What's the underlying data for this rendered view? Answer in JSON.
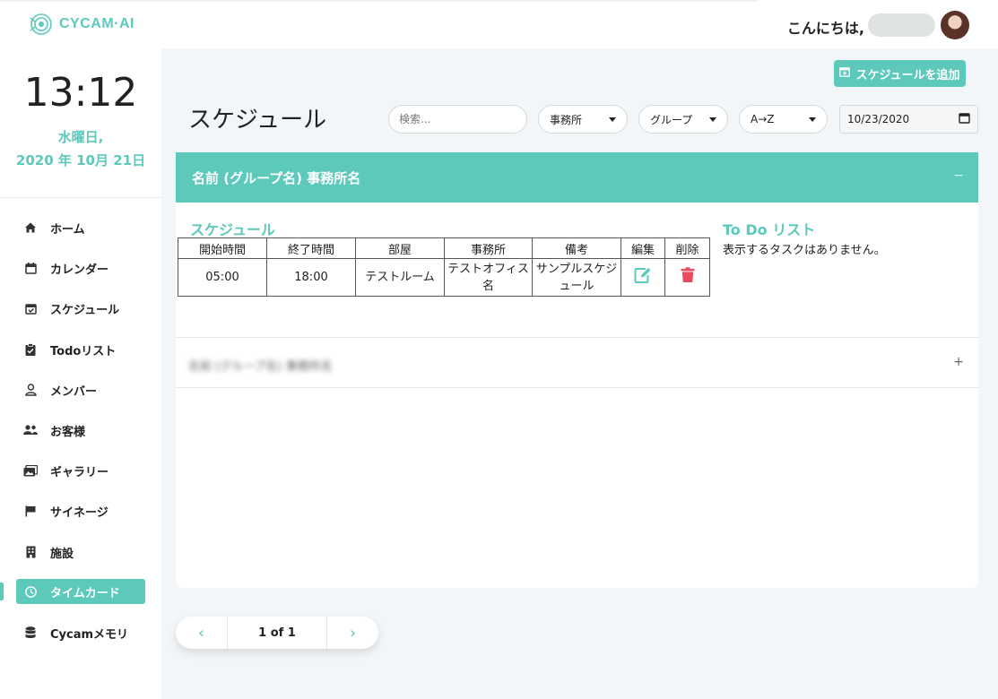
{
  "header": {
    "logo_text": "CYCAM·AI",
    "greeting": "こんにちは,"
  },
  "sidebar": {
    "time": "13:12",
    "date_line1": "水曜日,",
    "date_line2": "2020 年 10月 21日",
    "items": [
      {
        "label": "ホーム",
        "icon": "home-icon"
      },
      {
        "label": "カレンダー",
        "icon": "calendar-icon"
      },
      {
        "label": "スケジュール",
        "icon": "calendar-check-icon"
      },
      {
        "label": "Todoリスト",
        "icon": "clipboard-check-icon"
      },
      {
        "label": "メンバー",
        "icon": "user-icon"
      },
      {
        "label": "お客様",
        "icon": "users-icon"
      },
      {
        "label": "ギャラリー",
        "icon": "images-icon"
      },
      {
        "label": "サイネージ",
        "icon": "flag-icon"
      },
      {
        "label": "施設",
        "icon": "building-icon"
      },
      {
        "label": "タイムカード",
        "icon": "clock-icon",
        "active": true
      },
      {
        "label": "Cycamメモリ",
        "icon": "database-icon"
      }
    ]
  },
  "main": {
    "title": "スケジュール",
    "add_button": "スケジュールを追加",
    "search_placeholder": "検索...",
    "filters": {
      "office": "事務所",
      "group": "グループ",
      "sort": "A→Z",
      "date": "10/23/2020"
    }
  },
  "panel": {
    "header": "名前 (グループ名) 事務所名",
    "collapse_symbol": "−",
    "schedule_title": "スケジュール",
    "todo_title": "To Do リスト",
    "todo_empty": "表示するタスクはありません。",
    "columns": [
      "開始時間",
      "終了時間",
      "部屋",
      "事務所",
      "備考",
      "編集",
      "削除"
    ],
    "row": {
      "start": "05:00",
      "end": "18:00",
      "room": "テストルーム",
      "office": "テストオフィス名",
      "note": "サンプルスケジュール"
    },
    "second_row_label": "名前 (グループ名) 事務所名",
    "expand_symbol": "+"
  },
  "pagination": {
    "prev": "‹",
    "label": "1 of 1",
    "next": "›"
  },
  "colors": {
    "accent": "#5cc9bb",
    "delete": "#e84a5f"
  }
}
